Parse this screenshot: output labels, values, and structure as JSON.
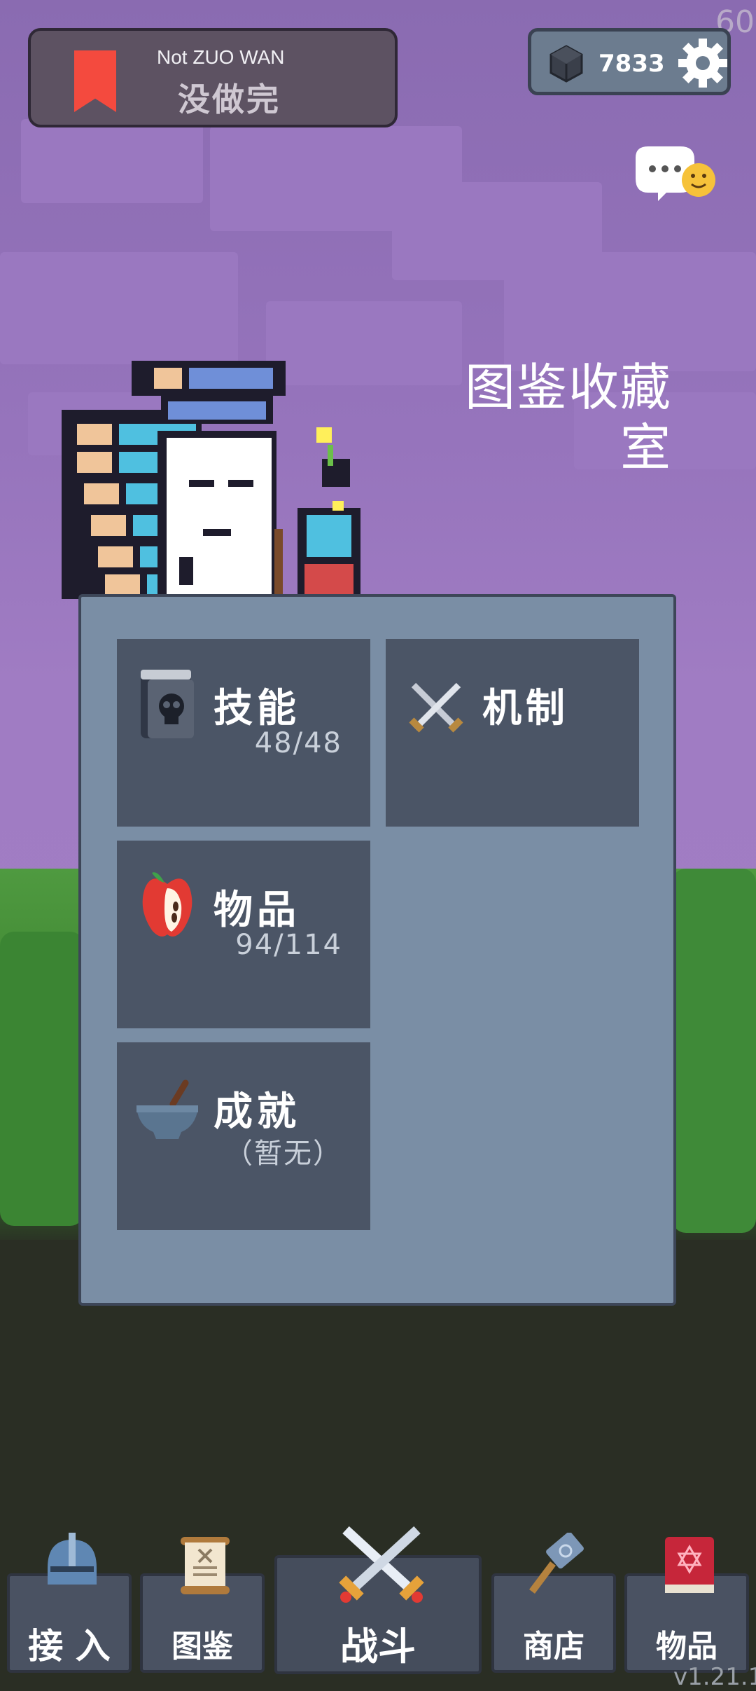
{
  "fps": "60",
  "banner": {
    "subtitle_en": "Not ZUO WAN",
    "title_cn": "没做完"
  },
  "currency": {
    "amount": "7833",
    "icon": "gem-hex-icon"
  },
  "settings": {
    "icon": "gear-icon"
  },
  "chat": {
    "icon": "chat-bubble-emoji-icon"
  },
  "page_title": {
    "line1": "图鉴收藏",
    "line2": "室"
  },
  "cards": [
    {
      "id": "skills",
      "label": "技能",
      "count": "48/48",
      "icon": "skull-book-icon"
    },
    {
      "id": "mechanics",
      "label": "机制",
      "count": "",
      "icon": "crossed-swords-icon"
    },
    {
      "id": "items",
      "label": "物品",
      "count": "94/114",
      "icon": "apple-icon"
    },
    {
      "id": "achievements",
      "label": "成就",
      "count": "（暂无）",
      "icon": "mortar-bowl-icon"
    }
  ],
  "nav": [
    {
      "id": "join",
      "label": "接 入",
      "icon": "helmet-icon"
    },
    {
      "id": "codex",
      "label": "图鉴",
      "icon": "scroll-icon"
    },
    {
      "id": "battle",
      "label": "战斗",
      "icon": "crossed-swords-icon"
    },
    {
      "id": "shop",
      "label": "商店",
      "icon": "hammer-icon"
    },
    {
      "id": "items",
      "label": "物品",
      "icon": "spellbook-icon"
    }
  ],
  "version": "v1.21.1"
}
